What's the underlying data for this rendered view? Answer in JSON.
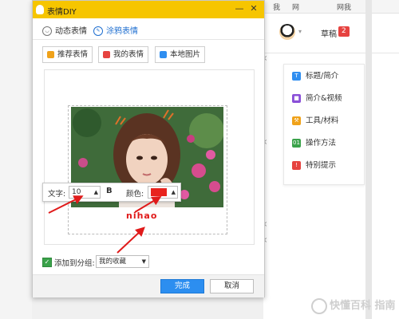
{
  "background": {
    "top_links": [
      "我",
      "网",
      "网我"
    ],
    "user": {
      "draft_label": "草稿",
      "draft_count": "2"
    },
    "side_nav": [
      {
        "label": "标题/简介",
        "icon": "title-icon",
        "color": "#2f8ef0"
      },
      {
        "label": "简介&视频",
        "icon": "video-icon",
        "color": "#8a4fd8"
      },
      {
        "label": "工具/材料",
        "icon": "tool-icon",
        "color": "#f0a21a"
      },
      {
        "label": "操作方法",
        "icon": "steps-icon",
        "color": "#3aa24a"
      },
      {
        "label": "特别提示",
        "icon": "tip-icon",
        "color": "#e64340"
      }
    ],
    "watermark": "快懂百科 指南"
  },
  "dialog": {
    "title": "表情DIY",
    "mode_tabs": [
      {
        "label": "动态表情",
        "icon": "smile-icon",
        "active": false
      },
      {
        "label": "涂鸦表情",
        "icon": "brush-icon",
        "active": true
      }
    ],
    "toolbar": {
      "recommend_label": "推荐表情",
      "mine_label": "我的表情",
      "local_label": "本地图片"
    },
    "text_toolbar": {
      "text_label": "文字:",
      "font_size": "10",
      "bold_label": "B",
      "color_label": "颜色:",
      "color": "#e8231d"
    },
    "caption_text": "nihao",
    "footer": {
      "add_to_group_label": "添加到分组:",
      "group_value": "我的收藏",
      "ok_label": "完成",
      "cancel_label": "取消"
    }
  },
  "colors": {
    "title_bar": "#f6c500",
    "primary_button": "#2c8ef0",
    "caption": "#e01a1a",
    "annotation_arrow": "#e01a1a"
  }
}
